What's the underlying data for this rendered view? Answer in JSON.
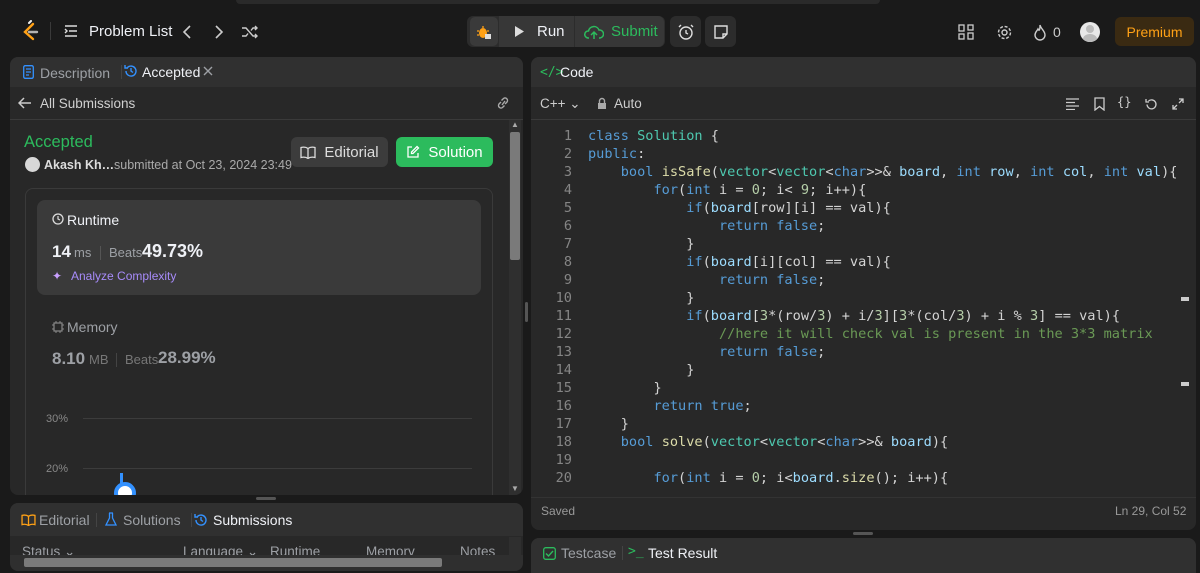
{
  "header": {
    "problem_list": "Problem List",
    "run": "Run",
    "submit": "Submit",
    "streak": "0",
    "premium": "Premium"
  },
  "left": {
    "tabs": {
      "description": "Description",
      "accepted": "Accepted"
    },
    "all_submissions": "All Submissions",
    "status": "Accepted",
    "user": "Akash Kh…",
    "submitted": "submitted at Oct 23, 2024 23:49",
    "editorial_btn": "Editorial",
    "solution_btn": "Solution",
    "runtime": {
      "title": "Runtime",
      "value": "14",
      "unit": "ms",
      "beats_label": "Beats",
      "beats": "49.73%",
      "analyze": "Analyze Complexity"
    },
    "memory": {
      "title": "Memory",
      "value": "8.10",
      "unit": "MB",
      "beats_label": "Beats",
      "beats": "28.99%"
    },
    "chart_data": {
      "type": "line",
      "yticks": [
        "30%",
        "20%"
      ],
      "ylim": [
        20,
        30
      ],
      "x": [],
      "values": []
    }
  },
  "bottom_left": {
    "tabs": {
      "editorial": "Editorial",
      "solutions": "Solutions",
      "submissions": "Submissions"
    },
    "columns": [
      "Status",
      "Language",
      "Runtime",
      "Memory",
      "Notes"
    ]
  },
  "code": {
    "title": "Code",
    "language": "C++",
    "mode": "Auto",
    "saved": "Saved",
    "cursor": "Ln 29, Col 52",
    "line_numbers": [
      "1",
      "2",
      "3",
      "4",
      "5",
      "6",
      "7",
      "8",
      "9",
      "10",
      "11",
      "12",
      "13",
      "14",
      "15",
      "16",
      "17",
      "18",
      "19",
      "20"
    ]
  },
  "bottom_right": {
    "testcase": "Testcase",
    "test_result": "Test Result"
  },
  "colors": {
    "accent_green": "#2cbb5d",
    "accepted": "#2cbb5d",
    "premium": "#ffa116",
    "blue": "#3391ff"
  }
}
